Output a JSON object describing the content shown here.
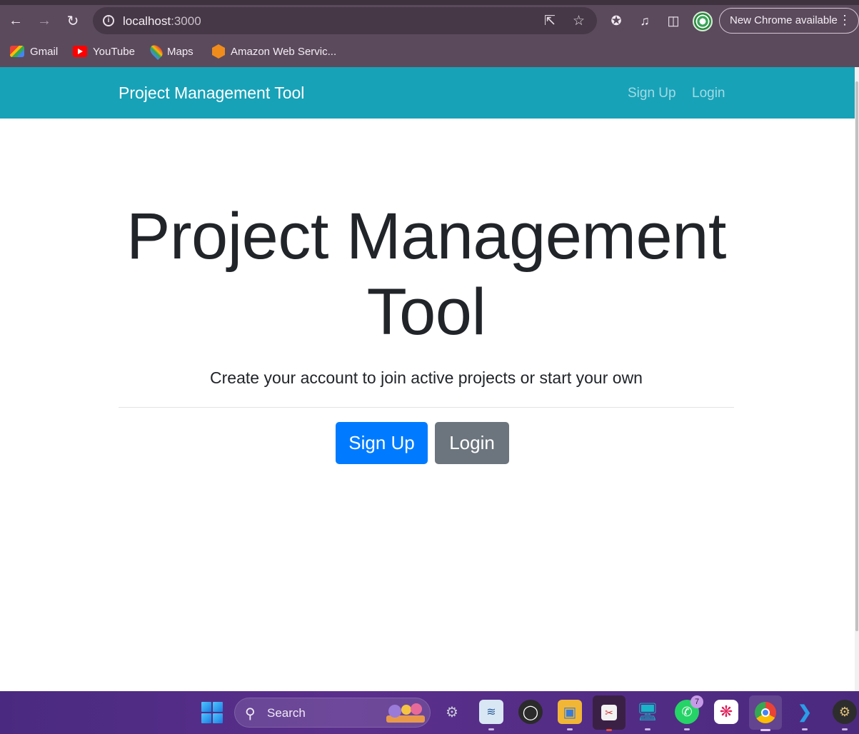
{
  "browser": {
    "url_host": "localhost",
    "url_port": ":3000",
    "update_label": "New Chrome available",
    "bookmarks": [
      {
        "label": "Gmail",
        "icon": "gmail-icon"
      },
      {
        "label": "YouTube",
        "icon": "youtube-icon"
      },
      {
        "label": "Maps",
        "icon": "maps-icon"
      },
      {
        "label": "Amazon Web Servic...",
        "icon": "aws-icon"
      }
    ]
  },
  "app": {
    "brand": "Project Management Tool",
    "nav": {
      "signup": "Sign Up",
      "login": "Login"
    },
    "hero": {
      "title_line1": "Project Management",
      "title_line2": "Tool",
      "lead": "Create your account to join active projects or start your own",
      "signup_button": "Sign Up",
      "login_button": "Login"
    },
    "colors": {
      "navbar": "#17a2b8",
      "primary": "#007bff",
      "secondary": "#6c757d"
    }
  },
  "taskbar": {
    "search_label": "Search",
    "whatsapp_badge": "7",
    "apps": [
      "start-icon",
      "settings-icon",
      "performance-monitor-icon",
      "obs-icon",
      "file-explorer-icon",
      "snipping-tool-icon",
      "remote-desktop-icon",
      "whatsapp-icon",
      "slack-icon",
      "chrome-icon",
      "vscode-icon",
      "extra-app-icon"
    ]
  }
}
